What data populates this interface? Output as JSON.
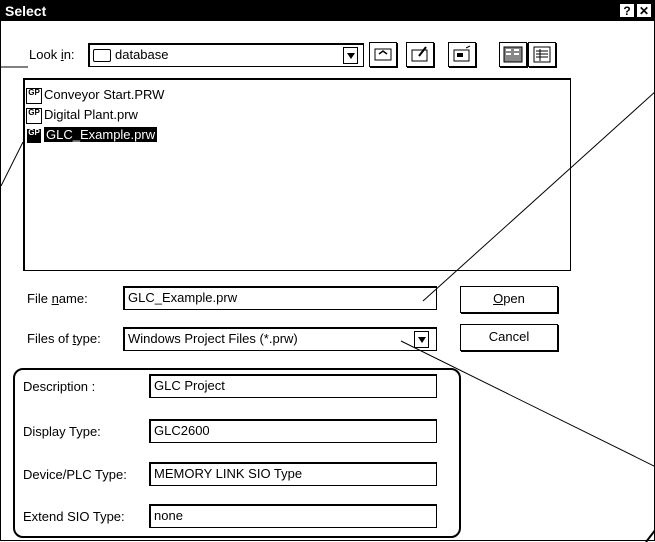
{
  "window": {
    "title": "Select",
    "help_label": "?",
    "close_label": "✕"
  },
  "lookin": {
    "label_pre": "Look ",
    "label_accel": "i",
    "label_post": "n:",
    "value": "database"
  },
  "toolbar": {
    "icons": [
      "up-one-level-icon",
      "create-new-folder-icon",
      "desktop-icon",
      "list-view-icon",
      "details-view-icon"
    ]
  },
  "files": [
    {
      "name": "Conveyor Start.PRW",
      "icon": "gp-file-icon",
      "selected": false
    },
    {
      "name": "Digital Plant.prw",
      "icon": "gp-file-icon",
      "selected": false
    },
    {
      "name": "GLC_Example.prw",
      "icon": "gp-file-icon",
      "selected": true
    }
  ],
  "filename": {
    "label_pre": "File ",
    "label_accel": "n",
    "label_post": "ame:",
    "value": "GLC_Example.prw"
  },
  "filetype": {
    "label_pre": "Files of ",
    "label_accel": "t",
    "label_post": "ype:",
    "value": "Windows Project Files (*.prw)"
  },
  "buttons": {
    "open_accel": "O",
    "open_rest": "pen",
    "cancel": "Cancel"
  },
  "info": {
    "description_label": "Description :",
    "description_value": "GLC Project",
    "display_label": "Display Type:",
    "display_value": "GLC2600",
    "device_label": "Device/PLC Type:",
    "device_value": "MEMORY LINK SIO Type",
    "extend_label": "Extend SIO Type:",
    "extend_value": "none"
  }
}
